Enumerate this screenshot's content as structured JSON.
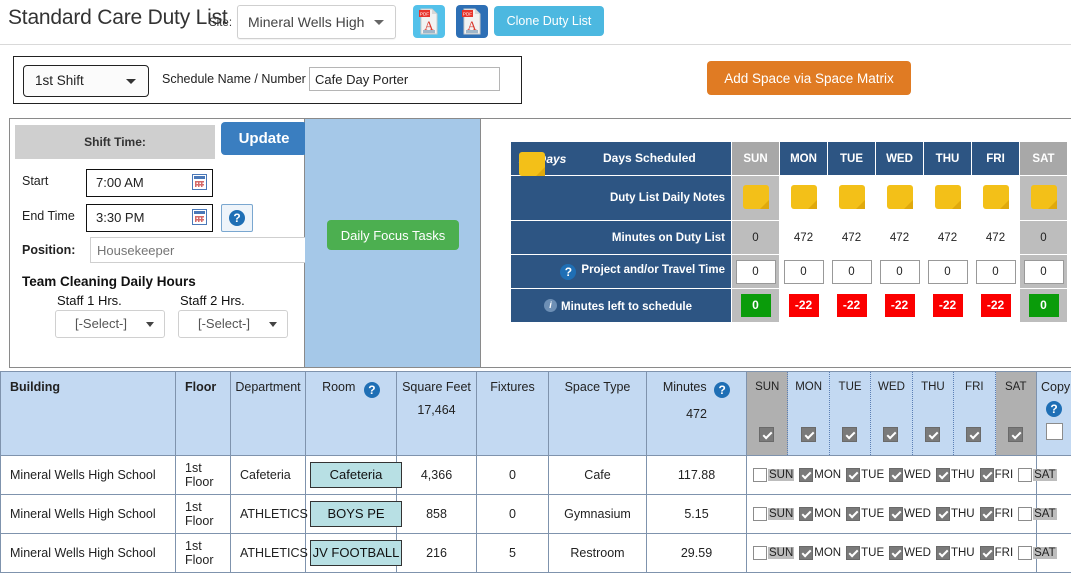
{
  "header": {
    "app_title": "Standard Care Duty List",
    "site_label": "Site:",
    "site_value": "Mineral Wells High",
    "pdf_icon_1": "pdf-icon",
    "pdf_icon_2": "pdf-icon",
    "clone_button": "Clone Duty List"
  },
  "shift_bar": {
    "shift_value": "1st Shift",
    "schedule_label": "Schedule Name / Number",
    "schedule_value": "Cafe Day Porter",
    "add_space_button": "Add Space via Space Matrix"
  },
  "shift_panel": {
    "shift_time_label": "Shift Time:",
    "update_button": "Update",
    "start_label": "Start",
    "start_value": "7:00 AM",
    "end_label": "End Time",
    "end_value": "3:30 PM",
    "help_icon": "question-mark-icon",
    "position_label": "Position:",
    "position_placeholder": "Housekeeper",
    "team_hours_title": "Team Cleaning Daily Hours",
    "staff1_label": "Staff 1 Hrs.",
    "staff1_value": "[-Select-]",
    "staff2_label": "Staff 2 Hrs.",
    "staff2_value": "[-Select-]"
  },
  "focus": {
    "button": "Daily Focus Tasks"
  },
  "days_scheduled": {
    "all_days_label": "All Days",
    "title": "Days Scheduled",
    "days": [
      "SUN",
      "MON",
      "TUE",
      "WED",
      "THU",
      "FRI",
      "SAT"
    ],
    "rows": [
      {
        "label": "Duty List Daily Notes",
        "icon": "sticky-note-icon",
        "values": [
          "",
          "",
          "",
          "",
          "",
          "",
          ""
        ]
      },
      {
        "label": "Minutes on Duty List",
        "values": [
          "0",
          "472",
          "472",
          "472",
          "472",
          "472",
          "0"
        ]
      },
      {
        "label": "Project and/or Travel Time",
        "icon": "question-mark-icon",
        "values": [
          "0",
          "0",
          "0",
          "0",
          "0",
          "0",
          "0"
        ]
      },
      {
        "label": "Minutes left to schedule",
        "icon": "info-icon",
        "values": [
          "0",
          "-22",
          "-22",
          "-22",
          "-22",
          "-22",
          "0"
        ],
        "states": [
          "green",
          "red",
          "red",
          "red",
          "red",
          "red",
          "green"
        ]
      }
    ]
  },
  "table": {
    "columns": {
      "building": "Building",
      "floor": "Floor",
      "department": "Department",
      "room": "Room",
      "square_feet": "Square Feet",
      "square_feet_total": "17,464",
      "fixtures": "Fixtures",
      "space_type": "Space Type",
      "minutes": "Minutes",
      "minutes_total": "472",
      "copy": "Copy"
    },
    "day_headers": [
      "SUN",
      "MON",
      "TUE",
      "WED",
      "THU",
      "FRI",
      "SAT"
    ],
    "day_header_checked": [
      true,
      true,
      true,
      true,
      true,
      true,
      true
    ],
    "rows": [
      {
        "building": "Mineral Wells High School",
        "floor": "1st Floor",
        "department": "Cafeteria",
        "room": "Cafeteria",
        "square_feet": "4,366",
        "fixtures": "0",
        "space_type": "Cafe",
        "minutes": "117.88",
        "days": [
          false,
          true,
          true,
          true,
          true,
          true,
          false
        ]
      },
      {
        "building": "Mineral Wells High School",
        "floor": "1st Floor",
        "department": "ATHLETICS",
        "room": "BOYS PE",
        "square_feet": "858",
        "fixtures": "0",
        "space_type": "Gymnasium",
        "minutes": "5.15",
        "days": [
          false,
          true,
          true,
          true,
          true,
          true,
          false
        ]
      },
      {
        "building": "Mineral Wells High School",
        "floor": "1st Floor",
        "department": "ATHLETICS",
        "room": "JV FOOTBALL",
        "square_feet": "216",
        "fixtures": "5",
        "space_type": "Restroom",
        "minutes": "29.59",
        "days": [
          false,
          true,
          true,
          true,
          true,
          true,
          false
        ]
      }
    ]
  },
  "colors": {
    "accent_blue": "#2d5583",
    "clone_blue": "#4cb8e0",
    "orange": "#e07b23",
    "green": "#4caf50",
    "status_green": "#0a9c0a",
    "status_red": "#fb0000",
    "header_row": "#c3d9f2",
    "focus_panel": "#a5c8e8"
  }
}
